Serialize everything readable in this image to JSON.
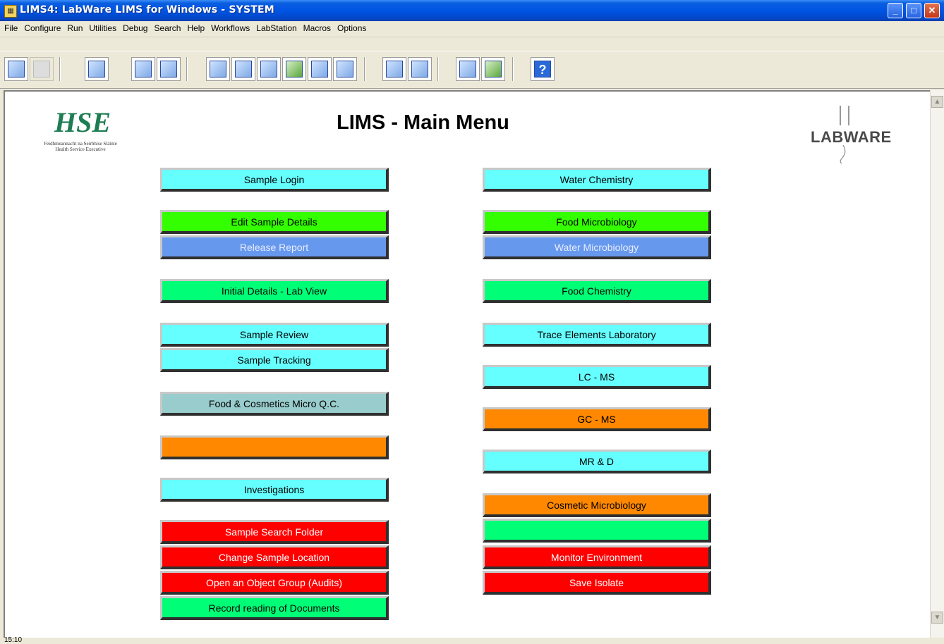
{
  "window": {
    "title": "LIMS4: LabWare LIMS for Windows - SYSTEM"
  },
  "menu": [
    "File",
    "Configure",
    "Run",
    "Utilities",
    "Debug",
    "Search",
    "Help",
    "Workflows",
    "LabStation",
    "Macros",
    "Options"
  ],
  "page": {
    "title": "LIMS - Main Menu"
  },
  "logos": {
    "hse_line1": "Feidhmeannacht na Seirbhíse Sláinte",
    "hse_line2": "Health Service Executive",
    "labware": "LABWARE"
  },
  "left_buttons": [
    {
      "label": "Sample Login",
      "color": "cyan"
    },
    {
      "label": "Edit Sample Details",
      "color": "green"
    },
    {
      "label": "Release Report",
      "color": "blue"
    },
    {
      "label": "Initial Details - Lab View",
      "color": "mint"
    },
    {
      "label": "Sample Review",
      "color": "cyan"
    },
    {
      "label": "Sample Tracking",
      "color": "cyan"
    },
    {
      "label": "Food & Cosmetics Micro Q.C.",
      "color": "grey"
    },
    {
      "label": "",
      "color": "orange"
    },
    {
      "label": "Investigations",
      "color": "cyan"
    },
    {
      "label": "Sample Search Folder",
      "color": "red"
    },
    {
      "label": "Change Sample Location",
      "color": "red"
    },
    {
      "label": "Open an Object Group (Audits)",
      "color": "red"
    },
    {
      "label": "Record reading of Documents",
      "color": "mint"
    }
  ],
  "right_buttons": [
    {
      "label": "Water Chemistry",
      "color": "cyan"
    },
    {
      "label": "Food Microbiology",
      "color": "green"
    },
    {
      "label": "Water Microbiology",
      "color": "blue"
    },
    {
      "label": "Food Chemistry",
      "color": "mint"
    },
    {
      "label": "Trace Elements Laboratory",
      "color": "cyan"
    },
    {
      "label": "LC - MS",
      "color": "cyan"
    },
    {
      "label": "GC - MS",
      "color": "orange"
    },
    {
      "label": "MR & D",
      "color": "cyan"
    },
    {
      "label": "Cosmetic Microbiology",
      "color": "orange"
    },
    {
      "label": "",
      "color": "mint"
    },
    {
      "label": "Monitor Environment",
      "color": "red"
    },
    {
      "label": "Save Isolate",
      "color": "red"
    }
  ],
  "status": {
    "time": "15:10"
  }
}
